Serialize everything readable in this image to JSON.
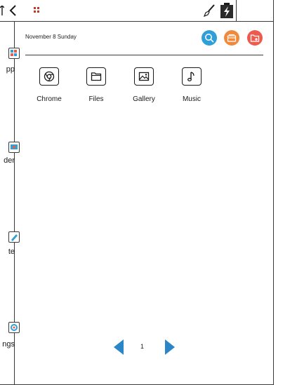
{
  "status_bar": {
    "back_icon": "chevron-left-icon",
    "app_icon": "app-dots-icon",
    "brush_icon": "brush-icon",
    "battery_icon": "battery-charging-icon"
  },
  "sidebar": {
    "items": [
      {
        "label": "pp",
        "icon": "app-icon"
      },
      {
        "label": "der",
        "icon": "reader-icon"
      },
      {
        "label": "te",
        "icon": "note-icon"
      },
      {
        "label": "ngs",
        "icon": "settings-icon"
      }
    ]
  },
  "header": {
    "date": "November 8  Sunday",
    "actions": [
      {
        "name": "search",
        "icon": "search-icon",
        "color": "#2f9fd8"
      },
      {
        "name": "cards",
        "icon": "cards-icon",
        "color": "#f08a3a"
      },
      {
        "name": "add-folder",
        "icon": "folder-plus-icon",
        "color": "#ee5a4e"
      }
    ]
  },
  "apps": [
    {
      "label": "Chrome",
      "icon": "chrome-icon"
    },
    {
      "label": "Files",
      "icon": "folder-icon"
    },
    {
      "label": "Gallery",
      "icon": "image-icon"
    },
    {
      "label": "Music",
      "icon": "music-note-icon"
    }
  ],
  "pager": {
    "page": "1",
    "arrow_color": "#2a86c7"
  }
}
